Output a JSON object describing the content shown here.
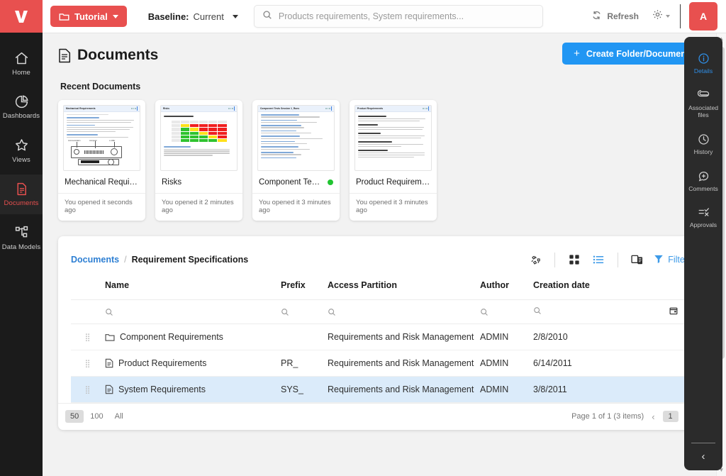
{
  "topbar": {
    "project_label": "Tutorial",
    "baseline_label": "Baseline:",
    "baseline_value": "Current",
    "search_placeholder": "Products requirements, System requirements...",
    "search_value": "",
    "refresh_label": "Refresh",
    "avatar_initial": "A"
  },
  "left_nav": {
    "items": [
      {
        "label": "Home",
        "icon": "home-icon"
      },
      {
        "label": "Dashboards",
        "icon": "pie-chart-icon"
      },
      {
        "label": "Views",
        "icon": "star-icon"
      },
      {
        "label": "Documents",
        "icon": "document-icon"
      },
      {
        "label": "Data Models",
        "icon": "data-model-icon"
      }
    ],
    "active": "Documents"
  },
  "right_panel": {
    "items": [
      {
        "label": "Details",
        "icon": "info-icon"
      },
      {
        "label": "Associated files",
        "icon": "paperclip-icon"
      },
      {
        "label": "History",
        "icon": "clock-icon"
      },
      {
        "label": "Comments",
        "icon": "comment-plus-icon"
      },
      {
        "label": "Approvals",
        "icon": "approvals-icon"
      }
    ],
    "active": "Details"
  },
  "page": {
    "title": "Documents",
    "create_button": "Create Folder/Document",
    "recent_title": "Recent Documents"
  },
  "recent_documents": [
    {
      "name": "Mechanical Requireme...",
      "meta": "You opened it seconds ago",
      "thumb_title": "Mechanical Requirements",
      "status": ""
    },
    {
      "name": "Risks",
      "meta": "You opened it 2 minutes ago",
      "thumb_title": "Risks",
      "status": ""
    },
    {
      "name": "Component Tests Se...",
      "meta": "You opened it 3 minutes ago",
      "thumb_title": "Component Tests Session 1_Runs",
      "status": "green"
    },
    {
      "name": "Product Requirements",
      "meta": "You opened it 3 minutes ago",
      "thumb_title": "Product Requirements",
      "status": ""
    }
  ],
  "table_card": {
    "breadcrumb_root": "Documents",
    "breadcrumb_sep": "/",
    "breadcrumb_current": "Requirement Specifications",
    "filter_label": "Filter",
    "tools": [
      "recycle-icon",
      "grid-view-icon",
      "list-view-icon",
      "duplicate-icon",
      "filter-icon"
    ],
    "columns": [
      "Name",
      "Prefix",
      "Access Partition",
      "Author",
      "Creation date"
    ],
    "rows": [
      {
        "icon": "folder-icon",
        "name": "Component Requirements",
        "prefix": "",
        "access": "Requirements and Risk Management",
        "author": "ADMIN",
        "created": "2/8/2010",
        "selected": false
      },
      {
        "icon": "file-icon",
        "name": "Product Requirements",
        "prefix": "PR_",
        "access": "Requirements and Risk Management",
        "author": "ADMIN",
        "created": "6/14/2011",
        "selected": false
      },
      {
        "icon": "file-icon",
        "name": "System Requirements",
        "prefix": "SYS_",
        "access": "Requirements and Risk Management",
        "author": "ADMIN",
        "created": "3/8/2011",
        "selected": true
      }
    ],
    "page_sizes": [
      "50",
      "100",
      "All"
    ],
    "page_size_active": "50",
    "page_info": "Page 1 of 1 (3 items)",
    "page_current": "1"
  },
  "colors": {
    "brand_red": "#e8504f",
    "accent_blue": "#2196f3",
    "link_blue": "#2d7fd3",
    "selected_row": "#dbebfa",
    "panel_dark": "#2b2b2b",
    "rail_dark": "#1b1b1b",
    "status_green": "#21c431"
  }
}
